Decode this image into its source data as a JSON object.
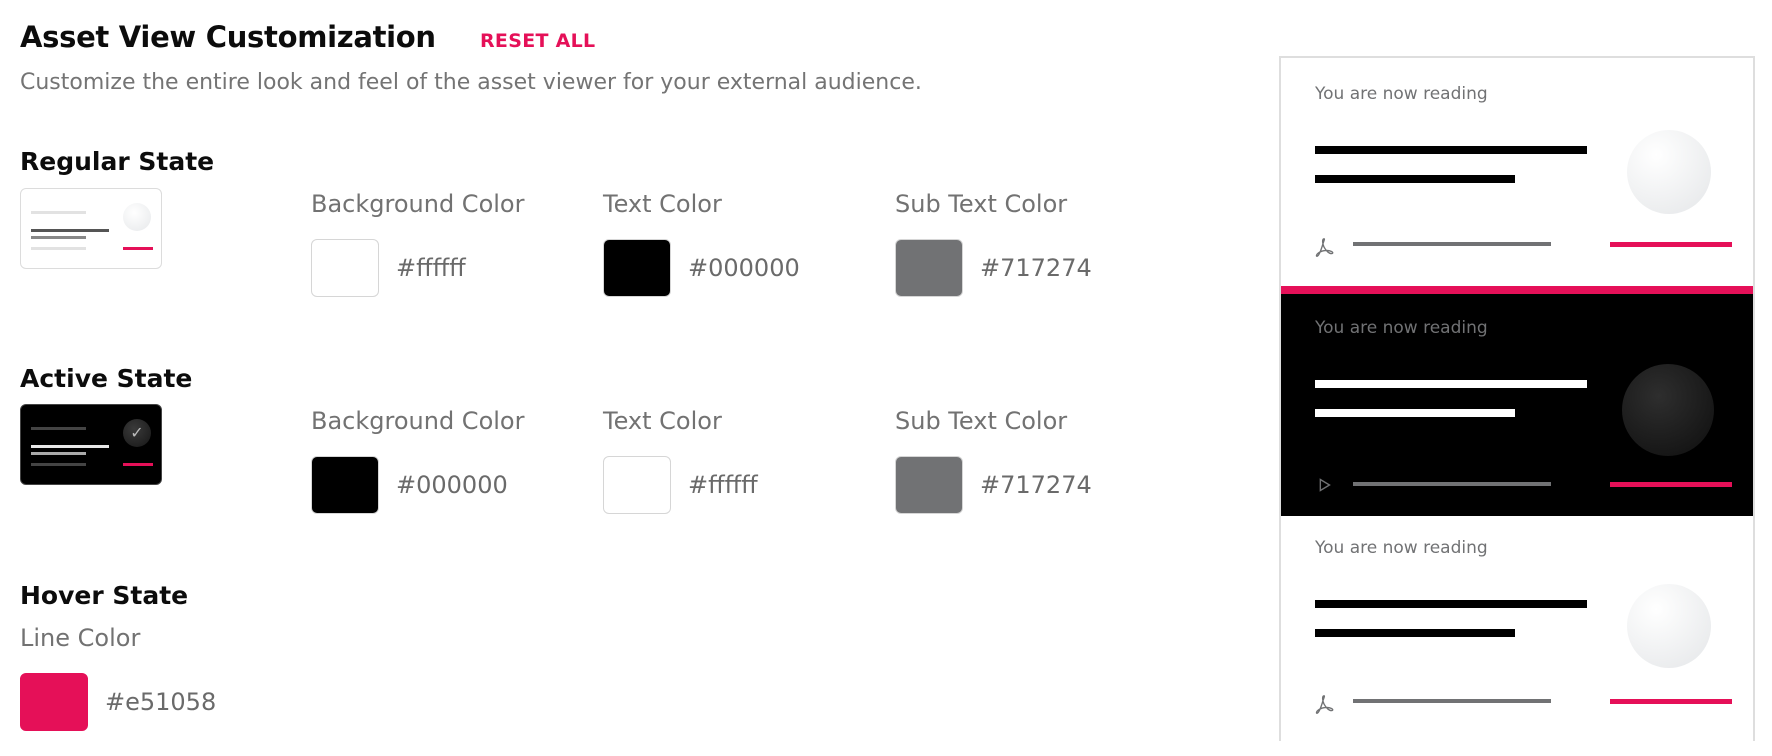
{
  "header": {
    "title": "Asset View Customization",
    "reset_label": "RESET ALL",
    "subtitle": "Customize the entire look and feel of the asset viewer for your external audience."
  },
  "regular": {
    "title": "Regular State",
    "background": {
      "label": "Background Color",
      "hex": "#ffffff"
    },
    "text": {
      "label": "Text Color",
      "hex": "#000000"
    },
    "subtext": {
      "label": "Sub Text Color",
      "hex": "#717274"
    }
  },
  "active": {
    "title": "Active State",
    "background": {
      "label": "Background Color",
      "hex": "#000000"
    },
    "text": {
      "label": "Text Color",
      "hex": "#ffffff"
    },
    "subtext": {
      "label": "Sub Text Color",
      "hex": "#717274"
    }
  },
  "hover": {
    "title": "Hover State",
    "line": {
      "label": "Line Color",
      "hex": "#e51058"
    }
  },
  "preview": {
    "cards": [
      {
        "reading": "You are now reading",
        "icon": "pdf-icon"
      },
      {
        "reading": "You are now reading",
        "icon": "play-icon"
      },
      {
        "reading": "You are now reading",
        "icon": "pdf-icon"
      }
    ]
  },
  "colors": {
    "accent": "#e51058",
    "subtext": "#717274"
  }
}
